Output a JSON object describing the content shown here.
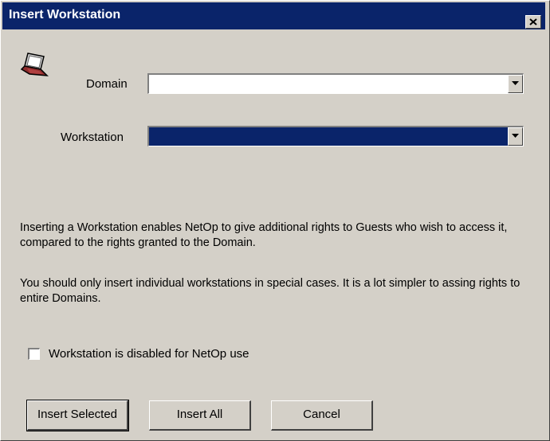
{
  "window": {
    "title": "Insert Workstation"
  },
  "icons": {
    "close": "close-icon",
    "laptop": "laptop-icon",
    "dropdown": "chevron-down-icon"
  },
  "form": {
    "domain_label": "Domain",
    "domain_value": "",
    "workstation_label": "Workstation",
    "workstation_value": ""
  },
  "info": {
    "paragraph1": "Inserting a Workstation enables NetOp to give additional rights to Guests who wish to access it, compared to the rights granted to the Domain.",
    "paragraph2": "You should only insert individual workstations in special cases. It is a lot simpler to assing rights to entire Domains."
  },
  "options": {
    "disabled_label": "Workstation is disabled for NetOp use",
    "disabled_checked": false
  },
  "buttons": {
    "insert_selected": "Insert Selected",
    "insert_all": "Insert All",
    "cancel": "Cancel"
  },
  "colors": {
    "titlebar": "#0a246a",
    "face": "#d4d0c8",
    "selection": "#0a246a"
  }
}
